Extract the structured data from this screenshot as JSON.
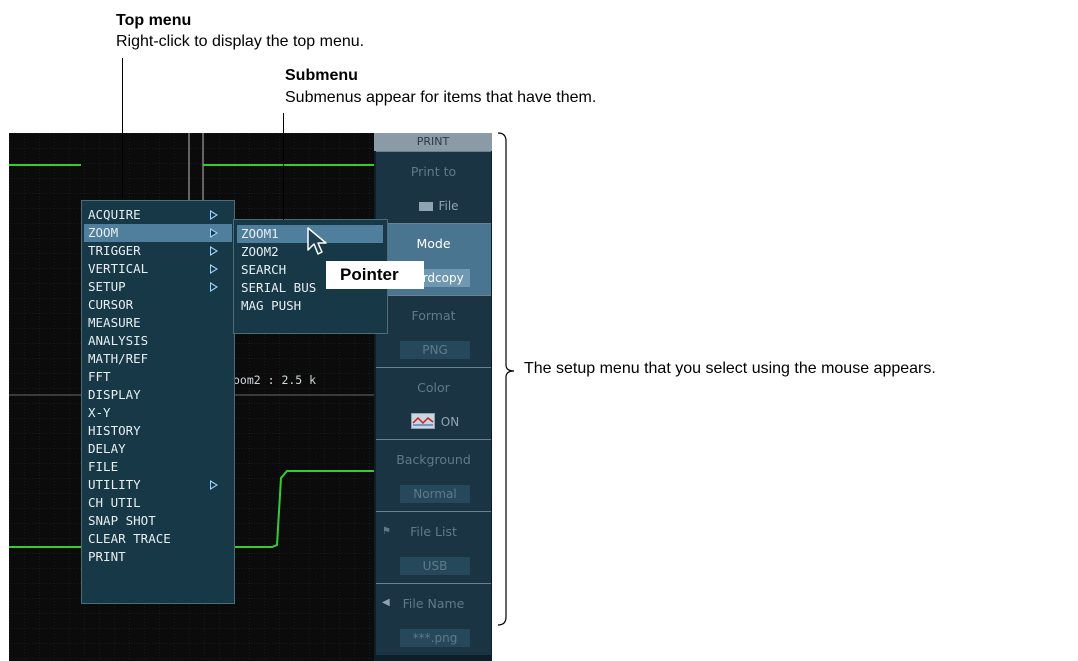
{
  "annotations": {
    "top_menu": {
      "title": "Top menu",
      "text": "Right-click to display the top menu."
    },
    "submenu": {
      "title": "Submenu",
      "text": "Submenus appear for items that have them."
    },
    "setup_menu_text": "The setup menu that you select using the mouse appears.",
    "pointer_label": "Pointer"
  },
  "top_menu": {
    "items": [
      {
        "label": "ACQUIRE",
        "submenu": true
      },
      {
        "label": "ZOOM",
        "submenu": true,
        "selected": true
      },
      {
        "label": "TRIGGER",
        "submenu": true
      },
      {
        "label": "VERTICAL",
        "submenu": true
      },
      {
        "label": "SETUP",
        "submenu": true
      },
      {
        "label": "CURSOR"
      },
      {
        "label": "MEASURE"
      },
      {
        "label": "ANALYSIS"
      },
      {
        "label": "MATH/REF"
      },
      {
        "label": "FFT"
      },
      {
        "label": "DISPLAY"
      },
      {
        "label": "X-Y"
      },
      {
        "label": "HISTORY"
      },
      {
        "label": "DELAY"
      },
      {
        "label": "FILE"
      },
      {
        "label": "UTILITY",
        "submenu": true
      },
      {
        "label": "CH UTIL"
      },
      {
        "label": "SNAP SHOT"
      },
      {
        "label": "CLEAR TRACE"
      },
      {
        "label": "PRINT"
      }
    ]
  },
  "submenu": {
    "items": [
      {
        "label": "ZOOM1",
        "selected": true
      },
      {
        "label": "ZOOM2"
      },
      {
        "label": "SEARCH"
      },
      {
        "label": "SERIAL BUS"
      },
      {
        "label": "MAG PUSH"
      }
    ]
  },
  "zoom_readout": "oom2 : 2.5 k",
  "panel": {
    "title": "PRINT",
    "items": [
      {
        "label": "Print to",
        "value": "File"
      },
      {
        "label": "Mode",
        "value": "Hardcopy",
        "active": true
      },
      {
        "label": "Format",
        "value": "PNG"
      },
      {
        "label": "Color",
        "value": "ON"
      },
      {
        "label": "Background",
        "value": "Normal"
      },
      {
        "label": "File List",
        "value": "USB"
      },
      {
        "label": "File Name",
        "value": "***.png"
      }
    ]
  },
  "colors": {
    "signal": "#33cc33",
    "menu_bg": "#173846",
    "menu_selected": "#4f7f9c",
    "panel_active": "#4a7590"
  }
}
